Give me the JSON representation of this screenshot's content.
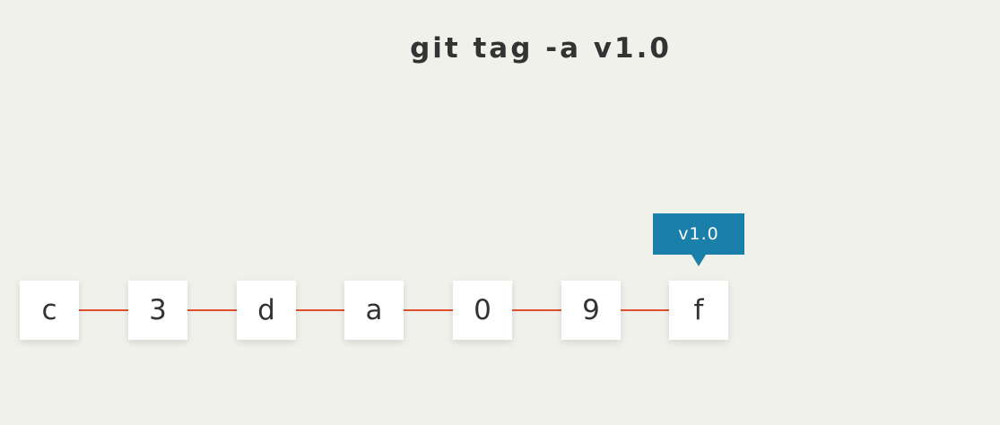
{
  "title": "git tag -a v1.0",
  "commits": [
    "c",
    "3",
    "d",
    "a",
    "0",
    "9",
    "f"
  ],
  "tag": {
    "label": "v1.0",
    "color": "#1a7fa9"
  },
  "colors": {
    "background": "#f1f1ec",
    "connector": "#e0502e",
    "node": "#ffffff",
    "text": "#333333"
  }
}
